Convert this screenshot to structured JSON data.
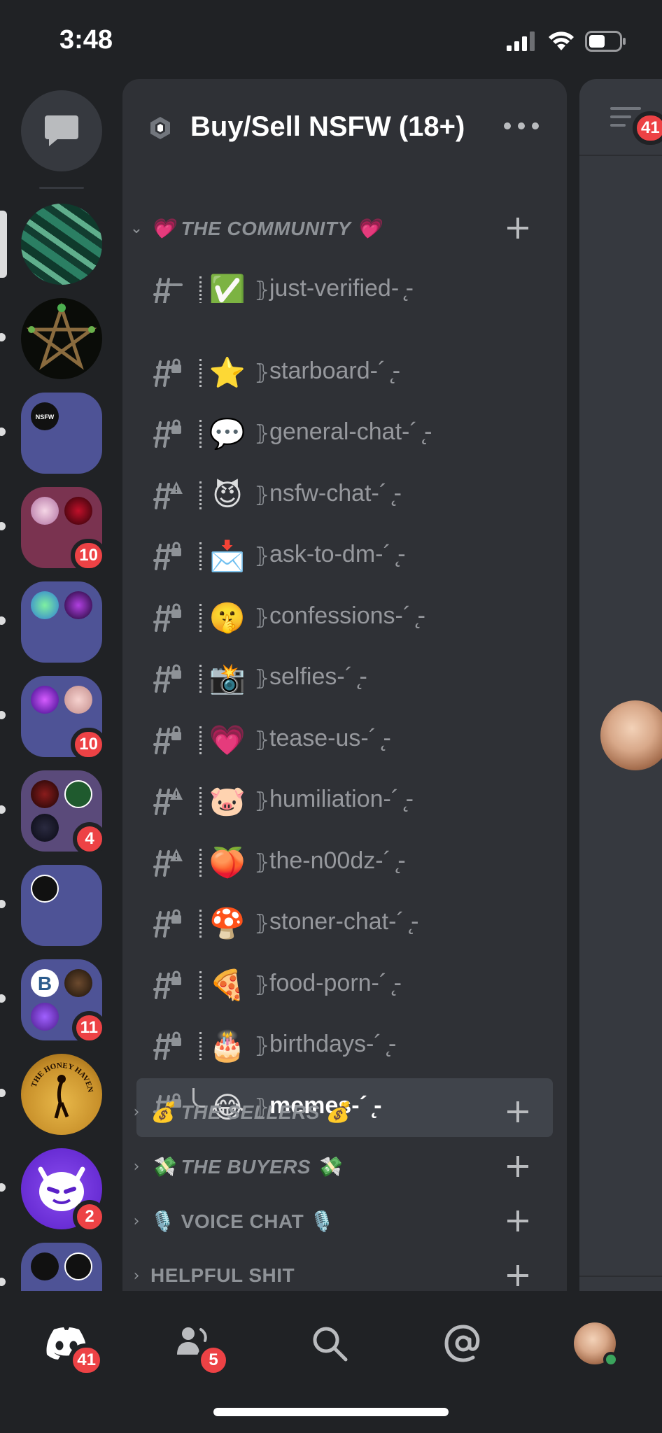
{
  "status_bar": {
    "time": "3:48"
  },
  "server_rail": {
    "servers": [
      {
        "name": "dm-button",
        "badge": null
      },
      {
        "name": "server-money",
        "badge": null,
        "active": true
      },
      {
        "name": "server-pentagram",
        "badge": null
      },
      {
        "name": "server-folder-1",
        "badge": null
      },
      {
        "name": "server-folder-2",
        "badge": "10"
      },
      {
        "name": "server-folder-3",
        "badge": null
      },
      {
        "name": "server-folder-4",
        "badge": "10"
      },
      {
        "name": "server-folder-5",
        "badge": "4"
      },
      {
        "name": "server-folder-6",
        "badge": null
      },
      {
        "name": "server-folder-7",
        "badge": "11"
      },
      {
        "name": "server-honey-haven",
        "badge": null
      },
      {
        "name": "server-community",
        "badge": "2"
      },
      {
        "name": "server-folder-8",
        "badge": null
      }
    ]
  },
  "guild": {
    "name": "Buy/Sell NSFW (18+)"
  },
  "categories": {
    "community": {
      "label": "💗 THE COMMUNITY 💗"
    },
    "sellers": {
      "label": "💰 THE SELLERS 💰"
    },
    "buyers": {
      "label": "💸 THE BUYERS 💸"
    },
    "voice": {
      "label": "🎙️ VOICE CHAT 🎙️"
    },
    "helpful": {
      "label": "HELPFUL SHIT"
    }
  },
  "channels": [
    {
      "emoji": "✅",
      "name": "just-verified-  ̨-",
      "icon": "hash-thread"
    },
    {
      "emoji": "⭐",
      "name": "starboard-´ ̨-",
      "icon": "hash-lock"
    },
    {
      "emoji": "💬",
      "name": "general-chat-´ ̨-",
      "icon": "hash-lock"
    },
    {
      "emoji": "😈",
      "name": "nsfw-chat-´ ̨-",
      "icon": "hash-warn"
    },
    {
      "emoji": "📩",
      "name": "ask-to-dm-´ ̨-",
      "icon": "hash-lock"
    },
    {
      "emoji": "🤫",
      "name": "confessions-´ ̨-",
      "icon": "hash-lock"
    },
    {
      "emoji": "📸",
      "name": "selfies-´ ̨-",
      "icon": "hash-lock"
    },
    {
      "emoji": "💗",
      "name": "tease-us-´ ̨-",
      "icon": "hash-lock"
    },
    {
      "emoji": "🐷",
      "name": "humiliation-´ ̨-",
      "icon": "hash-warn"
    },
    {
      "emoji": "🍑",
      "name": "the-n00dz-´ ̨-",
      "icon": "hash-warn"
    },
    {
      "emoji": "🍄",
      "name": "stoner-chat-´ ̨-",
      "icon": "hash-lock"
    },
    {
      "emoji": "🍕",
      "name": "food-porn-´ ̨-",
      "icon": "hash-lock"
    },
    {
      "emoji": "🎂",
      "name": "birthdays-´ ̨-",
      "icon": "hash-lock"
    },
    {
      "emoji": "😂",
      "name": "memes-´ ̨-",
      "icon": "hash-lock",
      "active": true
    }
  ],
  "peek": {
    "header_badge": "41"
  },
  "tab_bar": {
    "home_badge": "41",
    "friends_badge": "5"
  },
  "colors": {
    "background": "#202225",
    "panel": "#2f3136",
    "active_channel": "#40444b",
    "badge": "#ed4245",
    "folder": "#4e5396"
  }
}
